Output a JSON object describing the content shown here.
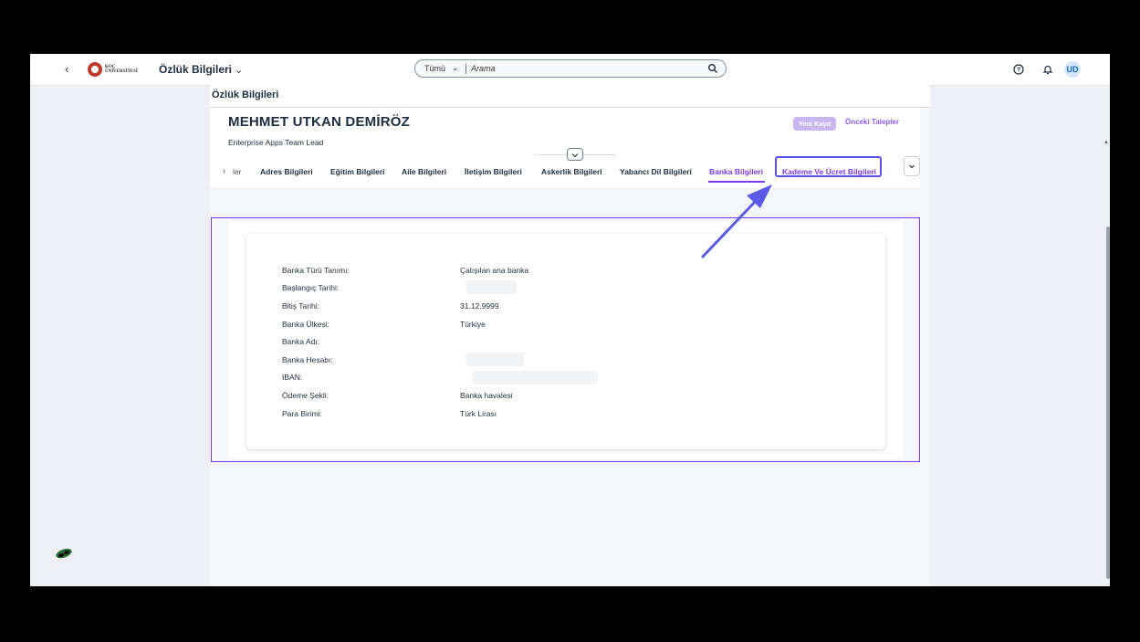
{
  "shellbar": {
    "logo_text_line1": "KOÇ",
    "logo_text_line2": "ÜNİVERSİTESİ",
    "app_title": "Özlük Bilgileri",
    "search_scope": "Tümü",
    "search_placeholder": "Arama",
    "avatar_initials": "UD"
  },
  "page": {
    "title": "Özlük Bilgileri",
    "employee_name": "MEHMET UTKAN DEMİRÖZ",
    "employee_role": "Enterprise Apps Team Lead",
    "new_record_label": "Yeni Kayıt",
    "previous_requests_label": "Önceki Talepler"
  },
  "tabs": {
    "truncated_first": "ler",
    "items": [
      {
        "label": "Adres Bilgileri"
      },
      {
        "label": "Eğitim Bilgileri"
      },
      {
        "label": "Aile Bilgileri"
      },
      {
        "label": "İletişim Bilgileri"
      },
      {
        "label": "Askerlik Bilgileri"
      },
      {
        "label": "Yabancı Dil Bilgileri"
      },
      {
        "label": "Banka Bilgileri",
        "active": true
      },
      {
        "label": "Kademe Ve Ücret Bilgileri",
        "highlighted": true
      }
    ]
  },
  "bank_info": {
    "fields": [
      {
        "label": "Banka Türü Tanımı:",
        "value": "Çalışılan ana banka"
      },
      {
        "label": "Başlangıç Tarihi:",
        "value": "",
        "redacted": true
      },
      {
        "label": "Bitiş Tarihi:",
        "value": "31.12.9999"
      },
      {
        "label": "Banka Ülkesi:",
        "value": "Türkiye"
      },
      {
        "label": "Banka Adı:",
        "value": ""
      },
      {
        "label": "Banka Hesabı:",
        "value": "",
        "redacted": true
      },
      {
        "label": "IBAN:",
        "value": "",
        "redacted": true
      },
      {
        "label": "Ödeme Şekli:",
        "value": "Banka havalesi"
      },
      {
        "label": "Para Birimi:",
        "value": "Türk Lirası"
      }
    ]
  },
  "colors": {
    "accent": "#7c3aed",
    "highlight": "#5b4fe9",
    "logo_red": "#c0392b"
  }
}
